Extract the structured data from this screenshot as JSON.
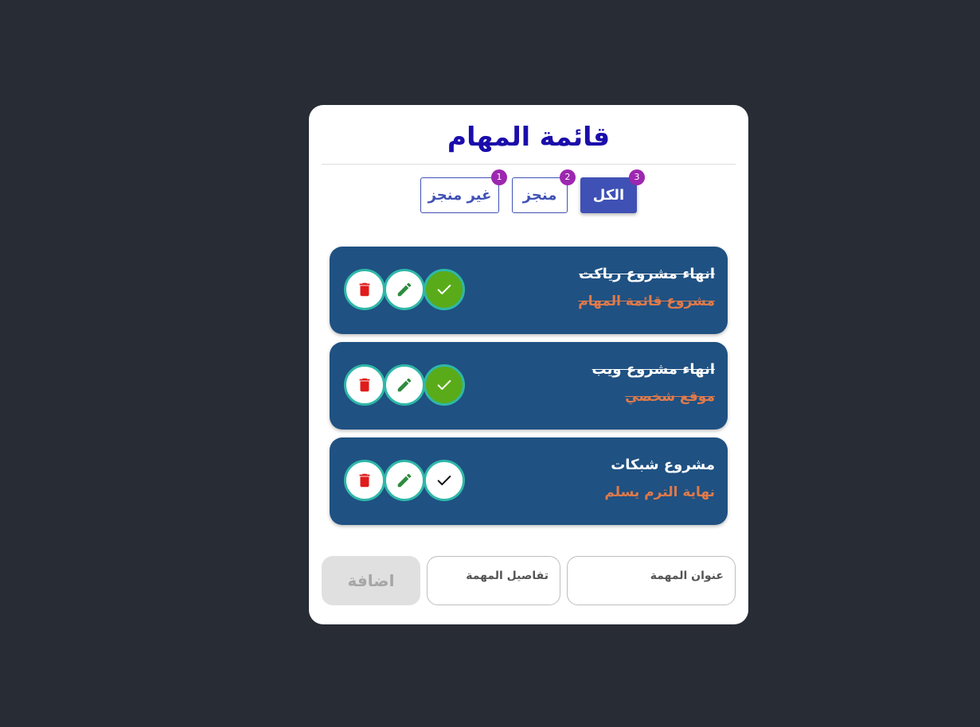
{
  "app": {
    "title": "قائمة المهام"
  },
  "filters": [
    {
      "label": "الكل",
      "count": "3",
      "active": true
    },
    {
      "label": "منجز",
      "count": "2",
      "active": false
    },
    {
      "label": "غير منجز",
      "count": "1",
      "active": false
    }
  ],
  "tasks": [
    {
      "title": "انهاء مشروع رياكت",
      "details": "مشروع قائمة المهام",
      "completed": true
    },
    {
      "title": "انهاء مشروع ويب",
      "details": "موقع شخصي",
      "completed": true
    },
    {
      "title": "مشروع شبكات",
      "details": "نهاية الترم يسلم",
      "completed": false
    }
  ],
  "form": {
    "title_label": "عنوان المهمة",
    "details_label": "تفاصيل المهمة",
    "add_label": "اضافة"
  },
  "colors": {
    "background": "#282c34",
    "card": "#ffffff",
    "title": "#1a0dab",
    "primary": "#3f51b5",
    "badge": "#9c27b0",
    "task_bg": "#1f5182",
    "task_detail": "#e07a4a",
    "check_done": "#5aab19",
    "edit_icon": "#2e8b3e",
    "delete_icon": "#e01b1b",
    "ring": "#2fb8a8"
  },
  "icons": {
    "check": "check-icon",
    "edit": "pencil-icon",
    "delete": "trash-icon"
  }
}
